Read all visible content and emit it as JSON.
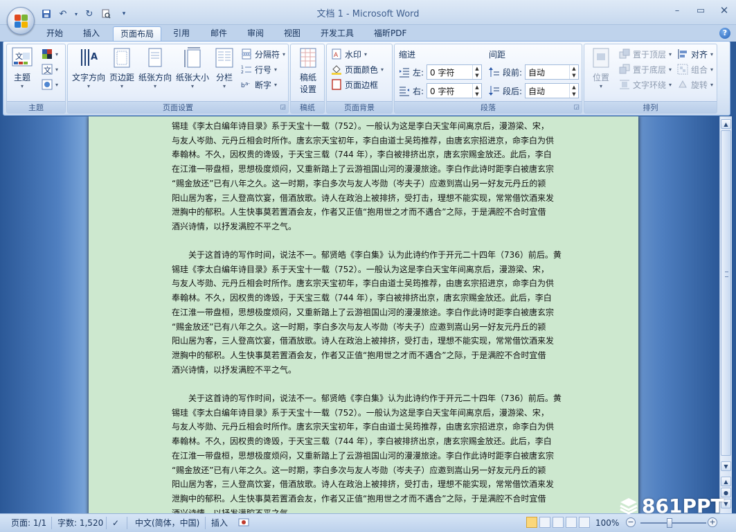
{
  "window": {
    "title": "文档 1 - Microsoft Word"
  },
  "tabs": [
    {
      "label": "开始"
    },
    {
      "label": "插入"
    },
    {
      "label": "页面布局"
    },
    {
      "label": "引用"
    },
    {
      "label": "邮件"
    },
    {
      "label": "审阅"
    },
    {
      "label": "视图"
    },
    {
      "label": "开发工具"
    },
    {
      "label": "福昕PDF"
    }
  ],
  "ribbon": {
    "themes": {
      "group_label": "主题",
      "theme_button": "主题"
    },
    "page_setup": {
      "group_label": "页面设置",
      "text_direction": "文字方向",
      "margins": "页边距",
      "orientation": "纸张方向",
      "size": "纸张大小",
      "columns": "分栏",
      "breaks": "分隔符",
      "line_numbers": "行号",
      "hyphenation": "断字"
    },
    "manuscript": {
      "group_label": "稿纸",
      "button_line1": "稿纸",
      "button_line2": "设置"
    },
    "page_background": {
      "group_label": "页面背景",
      "watermark": "水印",
      "page_color": "页面颜色",
      "page_borders": "页面边框"
    },
    "paragraph": {
      "group_label": "段落",
      "indent_title": "缩进",
      "spacing_title": "间距",
      "indent_left_label": "左:",
      "indent_left_value": "0 字符",
      "indent_right_label": "右:",
      "indent_right_value": "0 字符",
      "space_before_label": "段前:",
      "space_before_value": "自动",
      "space_after_label": "段后:",
      "space_after_value": "自动"
    },
    "arrange": {
      "group_label": "排列",
      "position": "位置",
      "bring_to_front": "置于顶层",
      "send_to_back": "置于底层",
      "text_wrapping": "文字环绕",
      "align": "对齐",
      "group": "组合",
      "rotate": "旋转"
    }
  },
  "document": {
    "partial_paragraph_lines": [
      "锡珪《李太白编年诗目录》系于天宝十一载（752）。一般认为这是李白天宝年间离京后，漫游梁、宋，",
      "与友人岑勋、元丹丘相会时所作。唐玄宗天宝初年，李白由道士吴筠推荐，由唐玄宗招进京，命李白为供",
      "奉翰林。不久，因权贵的谗毁，于天宝三载（744 年），李白被排挤出京，唐玄宗赐金放还。此后，李白",
      "在江淮一带盘桓，思想极度烦闷，又重新踏上了云游祖国山河的漫漫旅途。李白作此诗时距李白被唐玄宗",
      "“赐金放还”已有八年之久。这一时期，李白多次与友人岑勋（岑夫子）应邀到嵩山另一好友元丹丘的颍",
      "阳山居为客，三人登高饮宴，借酒放歌。诗人在政治上被排挤，受打击，理想不能实现，常常借饮酒来发",
      "泄胸中的郁积。人生快事莫若置酒会友，作者又正值“抱用世之才而不遇合”之际，于是满腔不合时宜借",
      "酒兴诗情，以抒发满腔不平之气。"
    ],
    "full_paragraph_lines": [
      "关于这首诗的写作时间，说法不一。郁贤皓《李白集》认为此诗约作于开元二十四年（736）前后。黄",
      "锡珪《李太白编年诗目录》系于天宝十一载（752）。一般认为这是李白天宝年间离京后，漫游梁、宋，",
      "与友人岑勋、元丹丘相会时所作。唐玄宗天宝初年，李白由道士吴筠推荐，由唐玄宗招进京，命李白为供",
      "奉翰林。不久，因权贵的谗毁，于天宝三载（744 年），李白被排挤出京，唐玄宗赐金放还。此后，李白",
      "在江淮一带盘桓，思想极度烦闷，又重新踏上了云游祖国山河的漫漫旅途。李白作此诗时距李白被唐玄宗",
      "“赐金放还”已有八年之久。这一时期，李白多次与友人岑勋（岑夫子）应邀到嵩山另一好友元丹丘的颍",
      "阳山居为客，三人登高饮宴，借酒放歌。诗人在政治上被排挤，受打击，理想不能实现，常常借饮酒来发",
      "泄胸中的郁积。人生快事莫若置酒会友，作者又正值“抱用世之才而不遇合”之际，于是满腔不合时宜借",
      "酒兴诗情，以抒发满腔不平之气。"
    ]
  },
  "status": {
    "page": "页面: 1/1",
    "words": "字数: 1,520",
    "language": "中文(简体，中国)",
    "insert_mode": "插入",
    "zoom": "100%"
  },
  "watermark_brand": "861PPT",
  "colors": {
    "page_background": "#cde8cf",
    "document_surround": "#4f7fc0",
    "ribbon_accent": "#8db2e3"
  }
}
